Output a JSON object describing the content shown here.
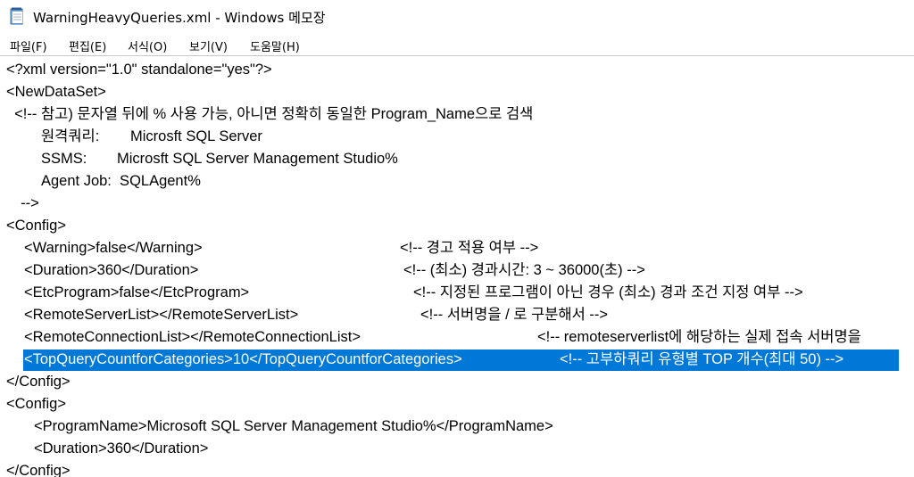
{
  "window": {
    "title": "WarningHeavyQueries.xml - Windows 메모장",
    "icon": "notepad-icon"
  },
  "menu": [
    "파일(F)",
    "편집(E)",
    "서식(O)",
    "보기(V)",
    "도움말(H)"
  ],
  "lines": [
    {
      "segments": [
        {
          "text": "<?xml version=\"1.0\" standalone=\"yes\"?>"
        }
      ]
    },
    {
      "segments": [
        {
          "text": "<NewDataSet>"
        }
      ]
    },
    {
      "segments": [
        {
          "text": "  <!-- 참고) 문자열 뒤에 % 사용 가능, 아니면 정확히 동일한 Program_Name으로 검색"
        }
      ]
    },
    {
      "segments": [
        {
          "text": "원격쿼리:"
        },
        {
          "text": "Microsft SQL Server"
        }
      ]
    },
    {
      "segments": [
        {
          "text": "SSMS:"
        },
        {
          "text": "Microsft SQL Server Management Studio%"
        }
      ]
    },
    {
      "segments": [
        {
          "text": "Agent Job:  SQLAgent%"
        }
      ]
    },
    {
      "segments": [
        {
          "text": "  -->"
        }
      ]
    },
    {
      "segments": [
        {
          "text": "<Config>"
        }
      ]
    },
    {
      "segments": [
        {
          "text": "<Warning>false</Warning>"
        },
        {
          "text": "<!-- 경고 적용 여부 -->"
        }
      ]
    },
    {
      "segments": [
        {
          "text": "<Duration>360</Duration>"
        },
        {
          "text": "<!-- (최소) 경과시간: 3 ~ 36000(초) -->"
        }
      ]
    },
    {
      "segments": [
        {
          "text": "<EtcProgram>false</EtcProgram>"
        },
        {
          "text": "<!-- 지정된 프로그램이 아닌 경우 (최소) 경과 조건 지정 여부 -->"
        }
      ]
    },
    {
      "segments": [
        {
          "text": "<RemoteServerList></RemoteServerList>"
        },
        {
          "text": "<!-- 서버명을 / 로 구분해서 -->"
        }
      ]
    },
    {
      "segments": [
        {
          "text": "<RemoteConnectionList></RemoteConnectionList>"
        },
        {
          "text": "<!-- remoteserverlist에 해당하는 실제 접속 서버명을"
        }
      ]
    },
    {
      "segments": [
        {
          "text": "<TopQueryCountforCategories>10</TopQueryCountforCategories>"
        },
        {
          "text": "<!-- 고부하쿼리 유형별 TOP 개수(최대 50) -->"
        }
      ],
      "selected": true
    },
    {
      "segments": [
        {
          "text": "</Config>"
        }
      ]
    },
    {
      "segments": [
        {
          "text": "<Config>"
        }
      ]
    },
    {
      "segments": [
        {
          "text": "<ProgramName>Microsoft SQL Server Management Studio%</ProgramName>"
        }
      ]
    },
    {
      "segments": [
        {
          "text": "<Duration>360</Duration>"
        }
      ]
    },
    {
      "segments": [
        {
          "text": "</Config>"
        }
      ]
    }
  ]
}
